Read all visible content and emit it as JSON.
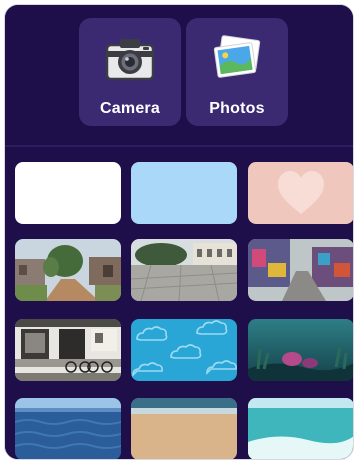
{
  "sources": {
    "camera": {
      "label": "Camera",
      "icon": "camera-icon"
    },
    "photos": {
      "label": "Photos",
      "icon": "photos-icon"
    }
  },
  "colors": {
    "background": "#1e0f4a",
    "button": "#3b2a72",
    "text": "#ffffff"
  },
  "backgrounds": [
    {
      "name": "plain-white"
    },
    {
      "name": "plain-light-blue"
    },
    {
      "name": "pink-heart"
    },
    {
      "name": "village-road"
    },
    {
      "name": "stone-plaza"
    },
    {
      "name": "graffiti-street"
    },
    {
      "name": "old-house-bicycles"
    },
    {
      "name": "blue-clouds-pattern"
    },
    {
      "name": "underwater-scene"
    },
    {
      "name": "ocean-horizon"
    },
    {
      "name": "sandy-beach"
    },
    {
      "name": "shallow-sea-waves"
    }
  ]
}
